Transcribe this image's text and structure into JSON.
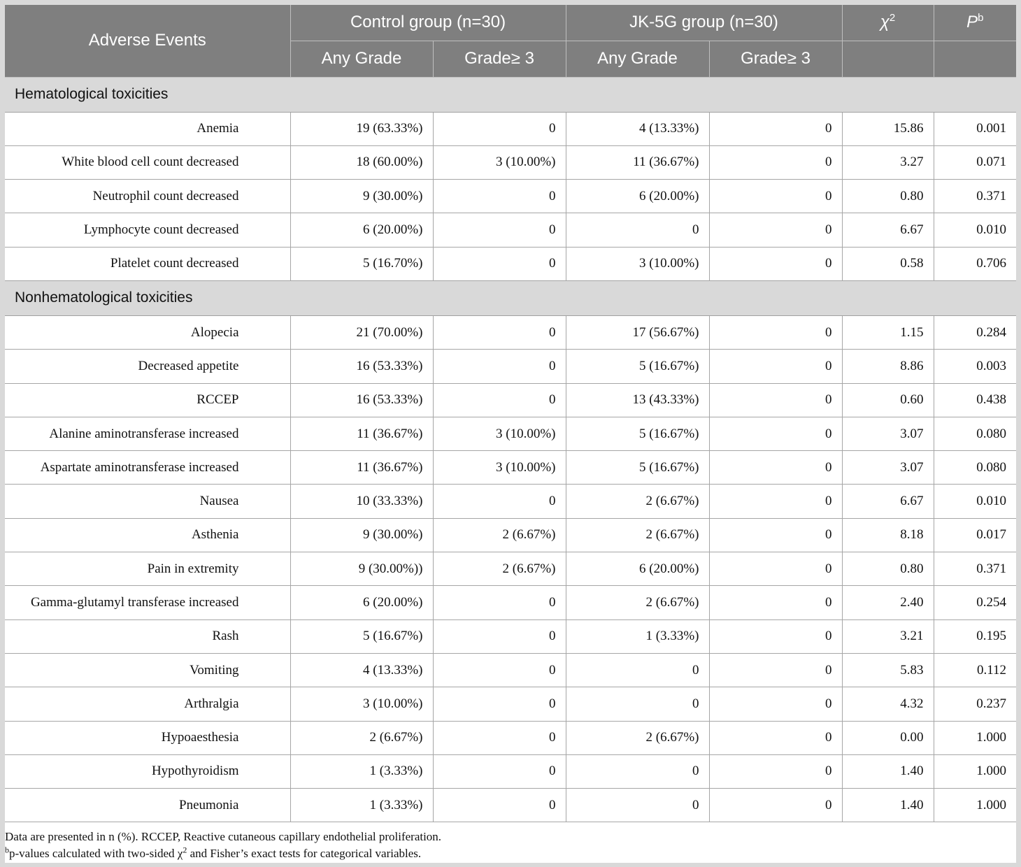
{
  "header": {
    "adverse_events": "Adverse Events",
    "control_group": "Control group (n=30)",
    "jk_group": "JK-5G group (n=30)",
    "chi": "χ",
    "chi_sup": "2",
    "p": "P",
    "p_sup": "b",
    "any_grade": "Any Grade",
    "grade3": "Grade≥ 3"
  },
  "sections": [
    {
      "title": "Hematological toxicities",
      "rows": [
        {
          "event": "Anemia",
          "c_any": "19 (63.33%)",
          "c_g3": "0",
          "j_any": "4 (13.33%)",
          "j_g3": "0",
          "chi": "15.86",
          "p": "0.001"
        },
        {
          "event": "White blood cell count decreased",
          "c_any": "18 (60.00%)",
          "c_g3": "3 (10.00%)",
          "j_any": "11 (36.67%)",
          "j_g3": "0",
          "chi": "3.27",
          "p": "0.071"
        },
        {
          "event": "Neutrophil count decreased",
          "c_any": "9 (30.00%)",
          "c_g3": "0",
          "j_any": "6 (20.00%)",
          "j_g3": "0",
          "chi": "0.80",
          "p": "0.371"
        },
        {
          "event": "Lymphocyte count decreased",
          "c_any": "6 (20.00%)",
          "c_g3": "0",
          "j_any": "0",
          "j_g3": "0",
          "chi": "6.67",
          "p": "0.010"
        },
        {
          "event": "Platelet count decreased",
          "c_any": "5 (16.70%)",
          "c_g3": "0",
          "j_any": "3 (10.00%)",
          "j_g3": "0",
          "chi": "0.58",
          "p": "0.706"
        }
      ]
    },
    {
      "title": "Nonhematological toxicities",
      "rows": [
        {
          "event": "Alopecia",
          "c_any": "21 (70.00%)",
          "c_g3": "0",
          "j_any": "17 (56.67%)",
          "j_g3": "0",
          "chi": "1.15",
          "p": "0.284"
        },
        {
          "event": "Decreased appetite",
          "c_any": "16 (53.33%)",
          "c_g3": "0",
          "j_any": "5 (16.67%)",
          "j_g3": "0",
          "chi": "8.86",
          "p": "0.003"
        },
        {
          "event": "RCCEP",
          "c_any": "16 (53.33%)",
          "c_g3": "0",
          "j_any": "13 (43.33%)",
          "j_g3": "0",
          "chi": "0.60",
          "p": "0.438"
        },
        {
          "event": "Alanine aminotransferase increased",
          "c_any": "11 (36.67%)",
          "c_g3": "3 (10.00%)",
          "j_any": "5 (16.67%)",
          "j_g3": "0",
          "chi": "3.07",
          "p": "0.080"
        },
        {
          "event": "Aspartate aminotransferase increased",
          "c_any": "11 (36.67%)",
          "c_g3": "3 (10.00%)",
          "j_any": "5 (16.67%)",
          "j_g3": "0",
          "chi": "3.07",
          "p": "0.080"
        },
        {
          "event": "Nausea",
          "c_any": "10 (33.33%)",
          "c_g3": "0",
          "j_any": "2 (6.67%)",
          "j_g3": "0",
          "chi": "6.67",
          "p": "0.010"
        },
        {
          "event": "Asthenia",
          "c_any": "9 (30.00%)",
          "c_g3": "2 (6.67%)",
          "j_any": "2 (6.67%)",
          "j_g3": "0",
          "chi": "8.18",
          "p": "0.017"
        },
        {
          "event": "Pain in extremity",
          "c_any": "9 (30.00%))",
          "c_g3": "2 (6.67%)",
          "j_any": "6 (20.00%)",
          "j_g3": "0",
          "chi": "0.80",
          "p": "0.371"
        },
        {
          "event": "Gamma-glutamyl transferase increased",
          "c_any": "6 (20.00%)",
          "c_g3": "0",
          "j_any": "2 (6.67%)",
          "j_g3": "0",
          "chi": "2.40",
          "p": "0.254"
        },
        {
          "event": "Rash",
          "c_any": "5 (16.67%)",
          "c_g3": "0",
          "j_any": "1 (3.33%)",
          "j_g3": "0",
          "chi": "3.21",
          "p": "0.195"
        },
        {
          "event": "Vomiting",
          "c_any": "4 (13.33%)",
          "c_g3": "0",
          "j_any": "0",
          "j_g3": "0",
          "chi": "5.83",
          "p": "0.112"
        },
        {
          "event": "Arthralgia",
          "c_any": "3 (10.00%)",
          "c_g3": "0",
          "j_any": "0",
          "j_g3": "0",
          "chi": "4.32",
          "p": "0.237"
        },
        {
          "event": "Hypoaesthesia",
          "c_any": "2 (6.67%)",
          "c_g3": "0",
          "j_any": "2 (6.67%)",
          "j_g3": "0",
          "chi": "0.00",
          "p": "1.000"
        },
        {
          "event": "Hypothyroidism",
          "c_any": "1 (3.33%)",
          "c_g3": "0",
          "j_any": "0",
          "j_g3": "0",
          "chi": "1.40",
          "p": "1.000"
        },
        {
          "event": "Pneumonia",
          "c_any": "1 (3.33%)",
          "c_g3": "0",
          "j_any": "0",
          "j_g3": "0",
          "chi": "1.40",
          "p": "1.000"
        }
      ]
    }
  ],
  "footnotes": {
    "line1": "Data are presented in n (%). RCCEP, Reactive cutaneous capillary endothelial proliferation.",
    "line2_sup": "b",
    "line2_a": "p-values calculated with two-sided χ",
    "line2_chi_sup": "2",
    "line2_b": " and Fisher’s exact tests for categorical variables."
  }
}
